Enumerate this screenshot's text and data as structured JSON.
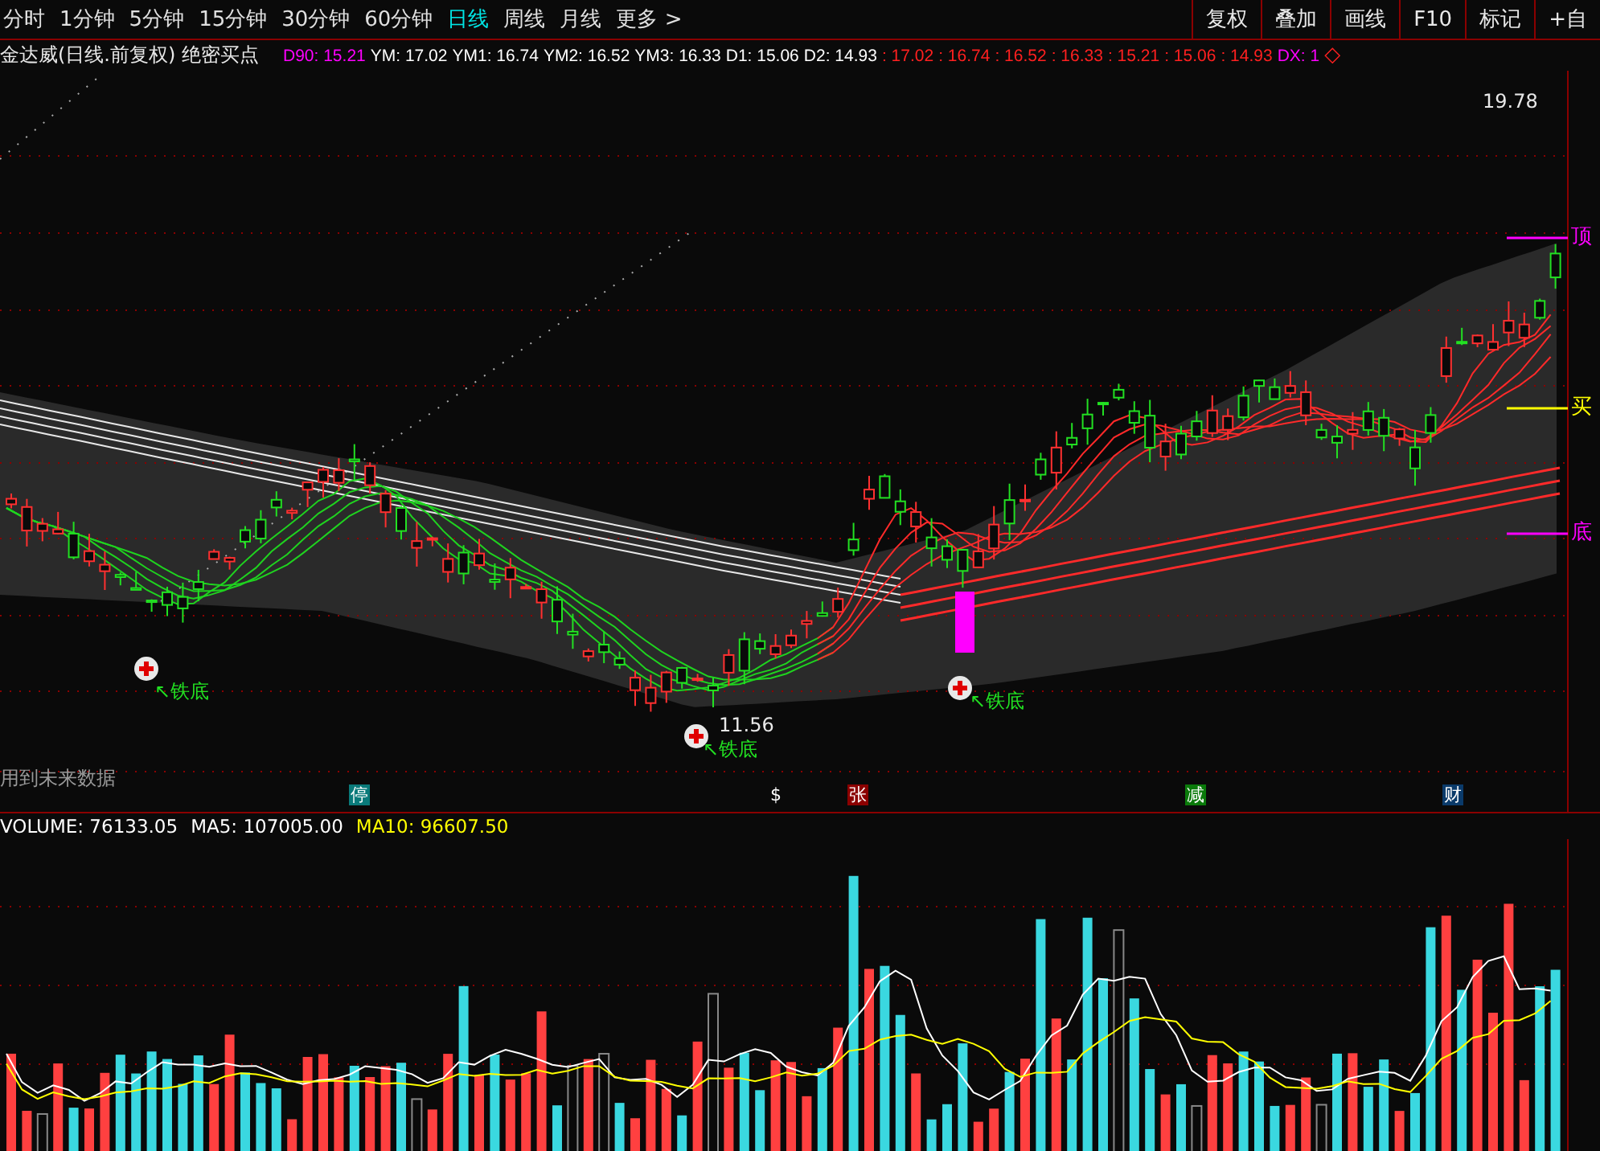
{
  "toolbar": {
    "periods": [
      {
        "label": "分时",
        "selected": false
      },
      {
        "label": "1分钟",
        "selected": false
      },
      {
        "label": "5分钟",
        "selected": false
      },
      {
        "label": "15分钟",
        "selected": false
      },
      {
        "label": "30分钟",
        "selected": false
      },
      {
        "label": "60分钟",
        "selected": false
      },
      {
        "label": "日线",
        "selected": true
      },
      {
        "label": "周线",
        "selected": false
      },
      {
        "label": "月线",
        "selected": false
      },
      {
        "label": "更多 >",
        "selected": false
      }
    ],
    "buttons": [
      "复权",
      "叠加",
      "画线",
      "F10",
      "标记",
      "+自"
    ]
  },
  "indicator_header": {
    "title": "金达威(日线.前复权) 绝密买点",
    "values": [
      {
        "text": "D90: 15.21",
        "color": "#ff00ff"
      },
      {
        "text": "YM: 17.02",
        "color": "#ffffff"
      },
      {
        "text": "YM1: 16.74",
        "color": "#ffffff"
      },
      {
        "text": "YM2: 16.52",
        "color": "#ffffff"
      },
      {
        "text": "YM3: 16.33",
        "color": "#ffffff"
      },
      {
        "text": "D1: 15.06",
        "color": "#ffffff"
      },
      {
        "text": "D2: 14.93",
        "color": "#ffffff"
      },
      {
        "text": ": 17.02",
        "color": "#ff2020"
      },
      {
        "text": ": 16.74",
        "color": "#ff2020"
      },
      {
        "text": ": 16.52",
        "color": "#ff2020"
      },
      {
        "text": ": 16.33",
        "color": "#ff2020"
      },
      {
        "text": ": 15.21",
        "color": "#ff2020"
      },
      {
        "text": ": 15.06",
        "color": "#ff2020"
      },
      {
        "text": ": 14.93",
        "color": "#ff2020"
      },
      {
        "text": "DX: 1",
        "color": "#ff00ff"
      },
      {
        "text": "◇",
        "color": "#ff2020"
      }
    ]
  },
  "price_chart": {
    "high_label": "19.78",
    "low_label": "11.56",
    "bottom_signals": [
      "↖铁底",
      "↖铁底",
      "↖铁底"
    ],
    "signal_lines": [
      {
        "label": "顶",
        "color": "#ff00ff"
      },
      {
        "label": "买",
        "color": "#ffff00"
      },
      {
        "label": "底",
        "color": "#ff00ff"
      }
    ],
    "note": "用到未来数据",
    "event_badges": [
      {
        "label": "停",
        "color": "#0a7a7a"
      },
      {
        "label": "$",
        "color": "#0a0a0a"
      },
      {
        "label": "张",
        "color": "#8b0000"
      },
      {
        "label": "减",
        "color": "#0a7a0a"
      },
      {
        "label": "财",
        "color": "#0a3a6a"
      }
    ]
  },
  "volume_header": [
    {
      "text": "VOLUME: 76133.05",
      "color": "#ffffff"
    },
    {
      "text": "MA5: 107005.00",
      "color": "#ffffff"
    },
    {
      "text": "MA10: 96607.50",
      "color": "#ffff00"
    }
  ]
}
